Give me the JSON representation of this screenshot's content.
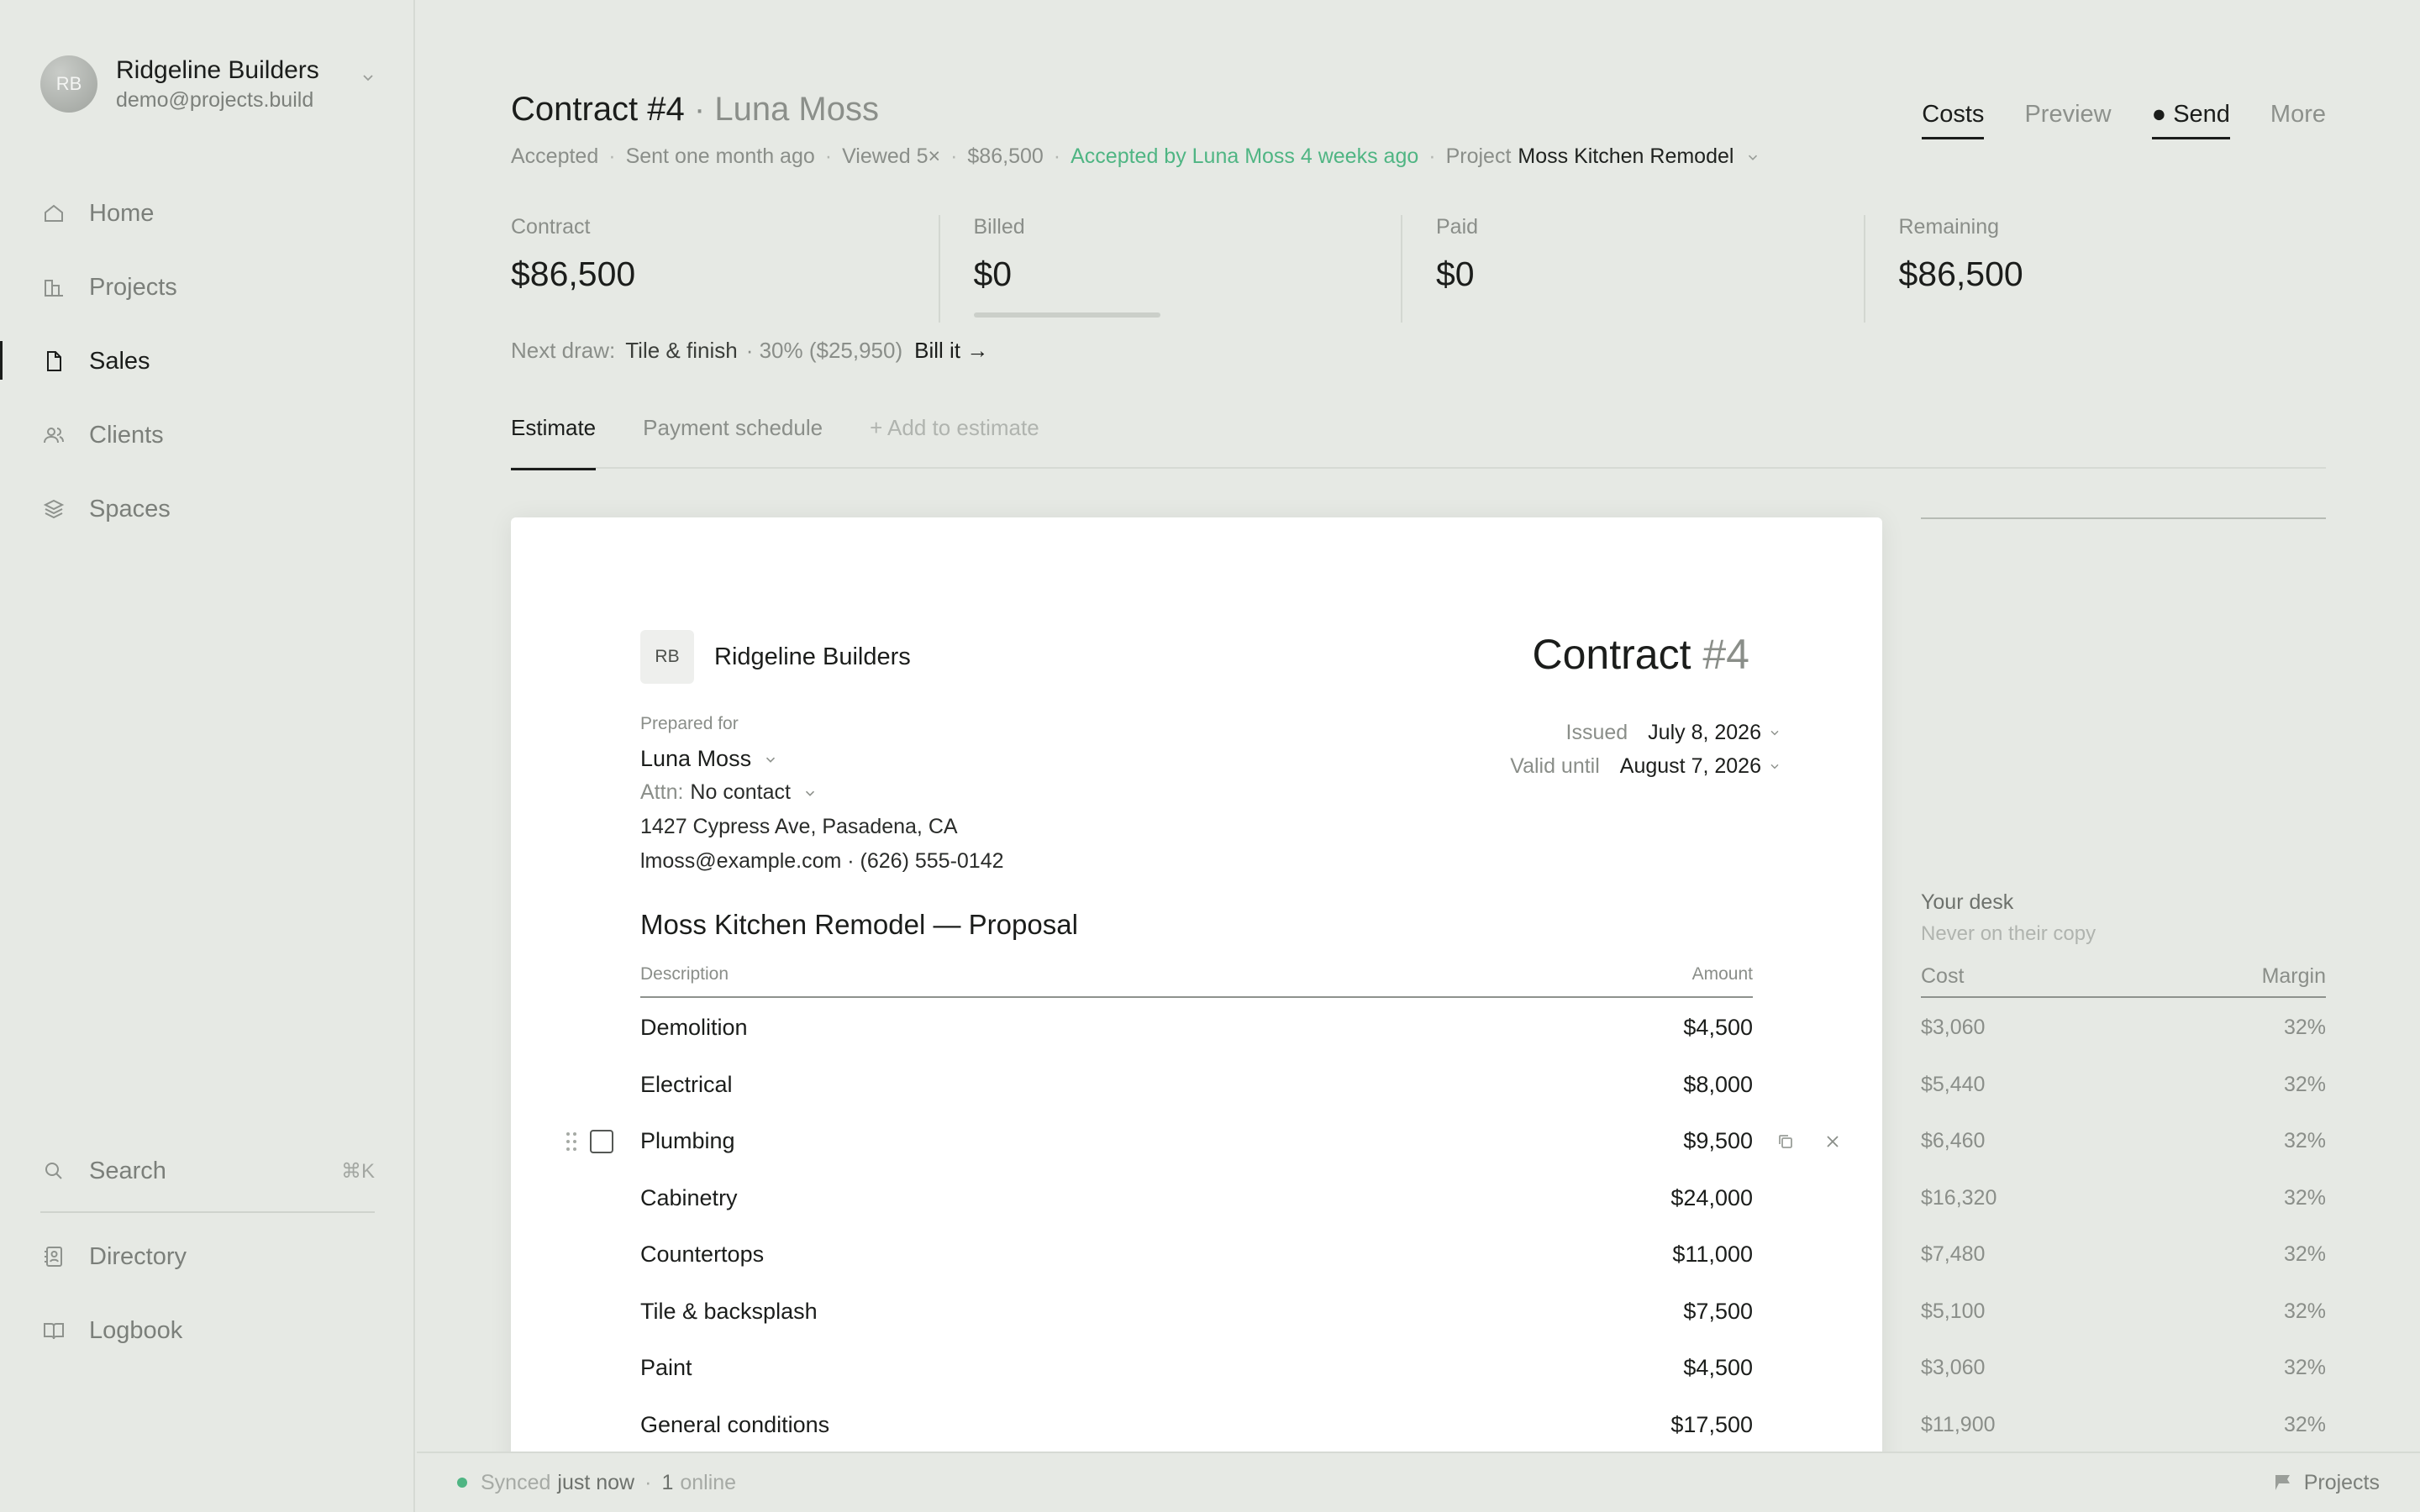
{
  "account": {
    "initials": "RB",
    "name": "Ridgeline Builders",
    "email": "demo@projects.build"
  },
  "sidebar": {
    "items": [
      {
        "label": "Home",
        "icon": "home-icon"
      },
      {
        "label": "Projects",
        "icon": "building-icon"
      },
      {
        "label": "Sales",
        "icon": "document-icon",
        "active": true
      },
      {
        "label": "Clients",
        "icon": "users-icon"
      },
      {
        "label": "Spaces",
        "icon": "layers-icon"
      }
    ],
    "search_label": "Search",
    "search_shortcut": "⌘K",
    "bottom_items": [
      {
        "label": "Directory",
        "icon": "contact-book-icon"
      },
      {
        "label": "Logbook",
        "icon": "book-icon"
      }
    ]
  },
  "header": {
    "title": "Contract #4",
    "title_sep": " · ",
    "title_client": "Luna Moss",
    "status": "Accepted",
    "sent": "Sent one month ago",
    "viewed": "Viewed 5×",
    "amount": "$86,500",
    "accepted_note": "Accepted by Luna Moss 4 weeks ago",
    "project_label": "Project",
    "project_name": "Moss Kitchen Remodel",
    "nav": {
      "costs": "Costs",
      "preview": "Preview",
      "send": "Send",
      "more": "More"
    }
  },
  "stats": [
    {
      "label": "Contract",
      "value": "$86,500"
    },
    {
      "label": "Billed",
      "value": "$0"
    },
    {
      "label": "Paid",
      "value": "$0"
    },
    {
      "label": "Remaining",
      "value": "$86,500"
    }
  ],
  "next_draw": {
    "label": "Next draw:",
    "name": "Tile & finish",
    "detail": "· 30% ($25,950)",
    "action": "Bill it →"
  },
  "tabs": {
    "estimate": "Estimate",
    "payment_schedule": "Payment schedule",
    "add": "+ Add to estimate"
  },
  "document": {
    "brand_initials": "RB",
    "brand_name": "Ridgeline Builders",
    "title": "Contract",
    "number": "#4",
    "prepared_label": "Prepared for",
    "client_name": "Luna Moss",
    "attn_label": "Attn:",
    "attn_value": "No contact",
    "address": "1427 Cypress Ave, Pasadena, CA",
    "contact": "lmoss@example.com · (626) 555-0142",
    "issued_label": "Issued",
    "issued_value": "July 8, 2026",
    "valid_label": "Valid until",
    "valid_value": "August 7, 2026",
    "proposal_title": "Moss Kitchen Remodel — Proposal",
    "col_description": "Description",
    "col_amount": "Amount",
    "items": [
      {
        "desc": "Demolition",
        "amount": "$4,500"
      },
      {
        "desc": "Electrical",
        "amount": "$8,000"
      },
      {
        "desc": "Plumbing",
        "amount": "$9,500"
      },
      {
        "desc": "Cabinetry",
        "amount": "$24,000"
      },
      {
        "desc": "Countertops",
        "amount": "$11,000"
      },
      {
        "desc": "Tile & backsplash",
        "amount": "$7,500"
      },
      {
        "desc": "Paint",
        "amount": "$4,500"
      },
      {
        "desc": "General conditions",
        "amount": "$17,500"
      }
    ]
  },
  "desk": {
    "title": "Your desk",
    "subtitle": "Never on their copy",
    "col_cost": "Cost",
    "col_margin": "Margin",
    "rows": [
      {
        "cost": "$3,060",
        "margin": "32%"
      },
      {
        "cost": "$5,440",
        "margin": "32%"
      },
      {
        "cost": "$6,460",
        "margin": "32%"
      },
      {
        "cost": "$16,320",
        "margin": "32%"
      },
      {
        "cost": "$7,480",
        "margin": "32%"
      },
      {
        "cost": "$5,100",
        "margin": "32%"
      },
      {
        "cost": "$3,060",
        "margin": "32%"
      },
      {
        "cost": "$11,900",
        "margin": "32%"
      }
    ]
  },
  "footer": {
    "synced_label": "Synced",
    "synced_value": "just now",
    "online_count": "1",
    "online_label": "online",
    "right_label": "Projects"
  },
  "colors": {
    "background": "#e6e9e4",
    "accent_green": "#4fb583",
    "text_primary": "#1b1d1b",
    "text_muted": "#8a8e89"
  }
}
